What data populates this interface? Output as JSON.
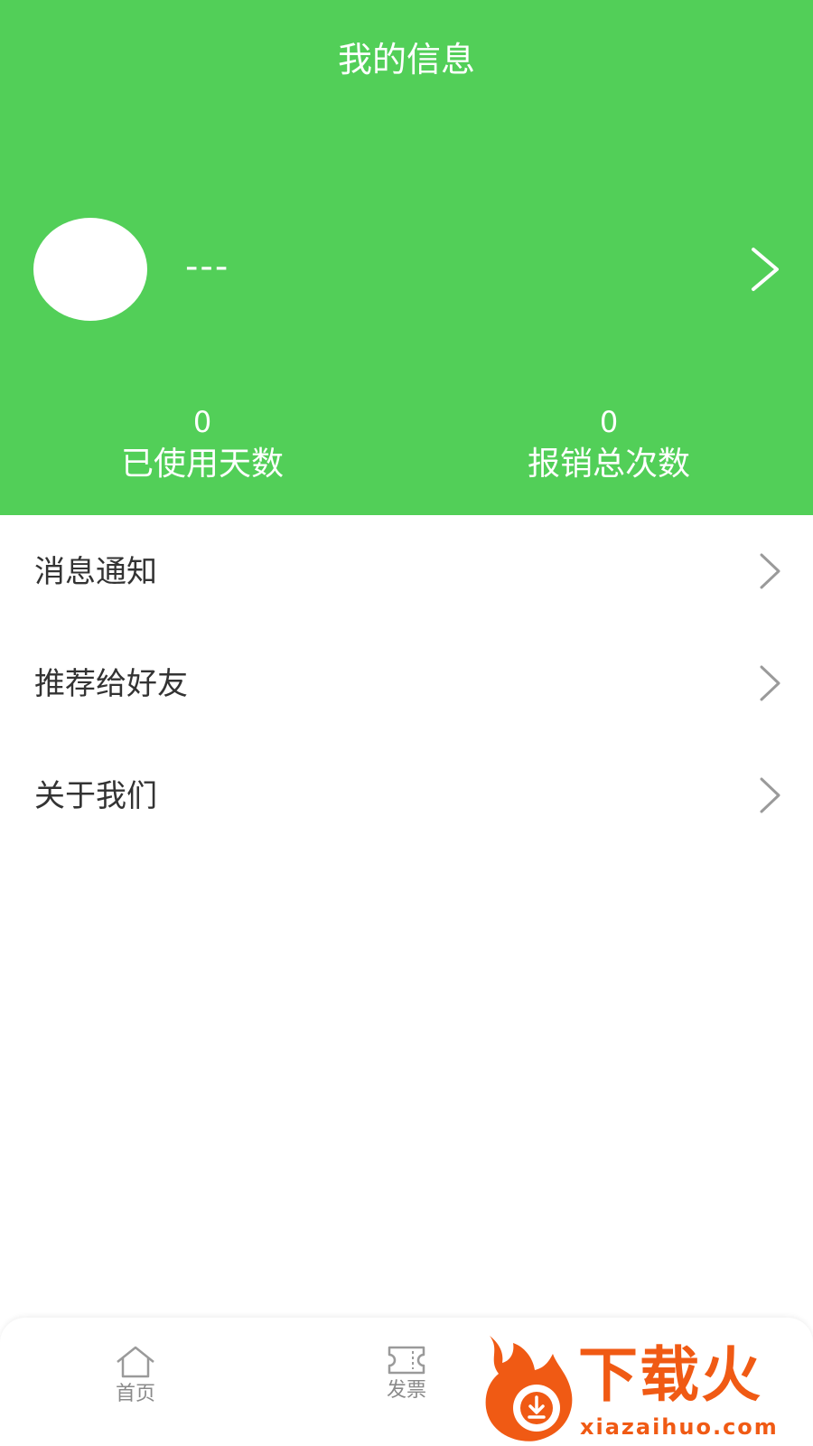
{
  "header": {
    "title": "我的信息",
    "background_color": "#52cf58",
    "profile": {
      "avatar": "avatar-placeholder",
      "username": "---"
    },
    "stats": [
      {
        "value": "0",
        "label": "已使用天数"
      },
      {
        "value": "0",
        "label": "报销总次数"
      }
    ]
  },
  "menu": {
    "items": [
      {
        "label": "消息通知",
        "icon": "chevron-right-icon"
      },
      {
        "label": "推荐给好友",
        "icon": "chevron-right-icon"
      },
      {
        "label": "关于我们",
        "icon": "chevron-right-icon"
      }
    ]
  },
  "tabbar": {
    "items": [
      {
        "label": "首页",
        "icon": "home-icon"
      },
      {
        "label": "发票",
        "icon": "ticket-icon"
      }
    ]
  },
  "watermark": {
    "text": "下载火",
    "url": "xiazaihuo.com",
    "color": "#f05a14"
  }
}
